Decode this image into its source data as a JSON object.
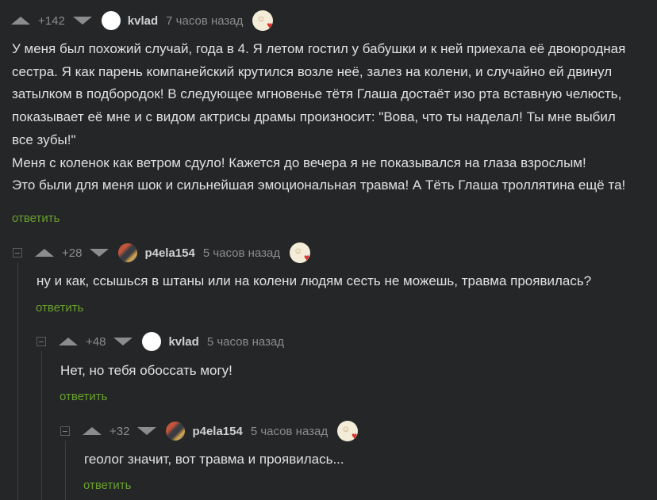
{
  "comments": [
    {
      "rating": "+142",
      "username": "kvlad",
      "time": "7 часов назад",
      "lines": [
        "У меня был похожий случай, года в 4. Я летом гостил у бабушки и к ней приехала её двоюродная",
        "сестра. Я как парень компанейский крутился возле неё, залез на колени, и случайно ей двинул",
        "затылком в подбородок! В следующее мгновенье тётя Глаша достаёт изо рта вставную челюсть,",
        "показывает её мне и с видом актрисы драмы произносит: \"Вова, что ты наделал! Ты мне выбил",
        "все зубы!\"",
        "Меня с коленок как ветром сдуло! Кажется до вечера я не показывался на глаза взрослым!",
        "Это были для меня шок и сильнейшая эмоциональная травма! А Тёть Глаша троллятина ещё та!"
      ],
      "reply_label": "ответить"
    },
    {
      "rating": "+28",
      "username": "p4ela154",
      "time": "5 часов назад",
      "lines": [
        "ну и как, ссышься в штаны или на колени людям сесть не можешь, травма проявилась?"
      ],
      "reply_label": "ответить"
    },
    {
      "rating": "+48",
      "username": "kvlad",
      "time": "5 часов назад",
      "lines": [
        "Нет, но тебя обоссать могу!"
      ],
      "reply_label": "ответить"
    },
    {
      "rating": "+32",
      "username": "p4ela154",
      "time": "5 часов назад",
      "lines": [
        "геолог значит, вот травма и проявилась..."
      ],
      "reply_label": "ответить"
    }
  ],
  "colors": {
    "background": "#242628",
    "reply_link": "#6aa12d",
    "muted": "#8a8c8e",
    "text": "#e0e1e1"
  },
  "icons": {
    "vote_up": "triangle-up-icon",
    "vote_down": "triangle-down-icon",
    "collapse": "minus-square-icon",
    "badge": "award-heart-icon"
  }
}
